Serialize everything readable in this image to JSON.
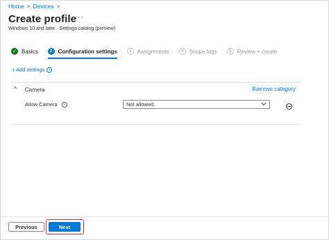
{
  "breadcrumb": {
    "items": [
      "Home",
      "Devices"
    ],
    "separator": ">"
  },
  "header": {
    "title": "Create profile",
    "more_label": "···",
    "subtitle": "Windows 10 and later - Settings catalog (preview)"
  },
  "wizard": {
    "steps": [
      {
        "number": "✓",
        "label": "Basics",
        "state": "done"
      },
      {
        "number": "2",
        "label": "Configuration settings",
        "state": "active"
      },
      {
        "number": "3",
        "label": "Assignments",
        "state": "todo"
      },
      {
        "number": "4",
        "label": "Scope tags",
        "state": "todo"
      },
      {
        "number": "5",
        "label": "Review + create",
        "state": "todo"
      }
    ]
  },
  "add_settings": {
    "label": "+ Add settings",
    "info_glyph": "i"
  },
  "category": {
    "chevron": "^",
    "title": "Camera",
    "remove_label": "Remove category",
    "setting": {
      "label": "Allow Camera",
      "info_glyph": "i",
      "value": "Not allowed.",
      "dropdown_icon": "chevron-down-icon"
    }
  },
  "footer": {
    "previous_label": "Previous",
    "next_label": "Next"
  },
  "colors": {
    "accent": "#0078d4",
    "success": "#107c10",
    "highlight": "#d13438"
  }
}
